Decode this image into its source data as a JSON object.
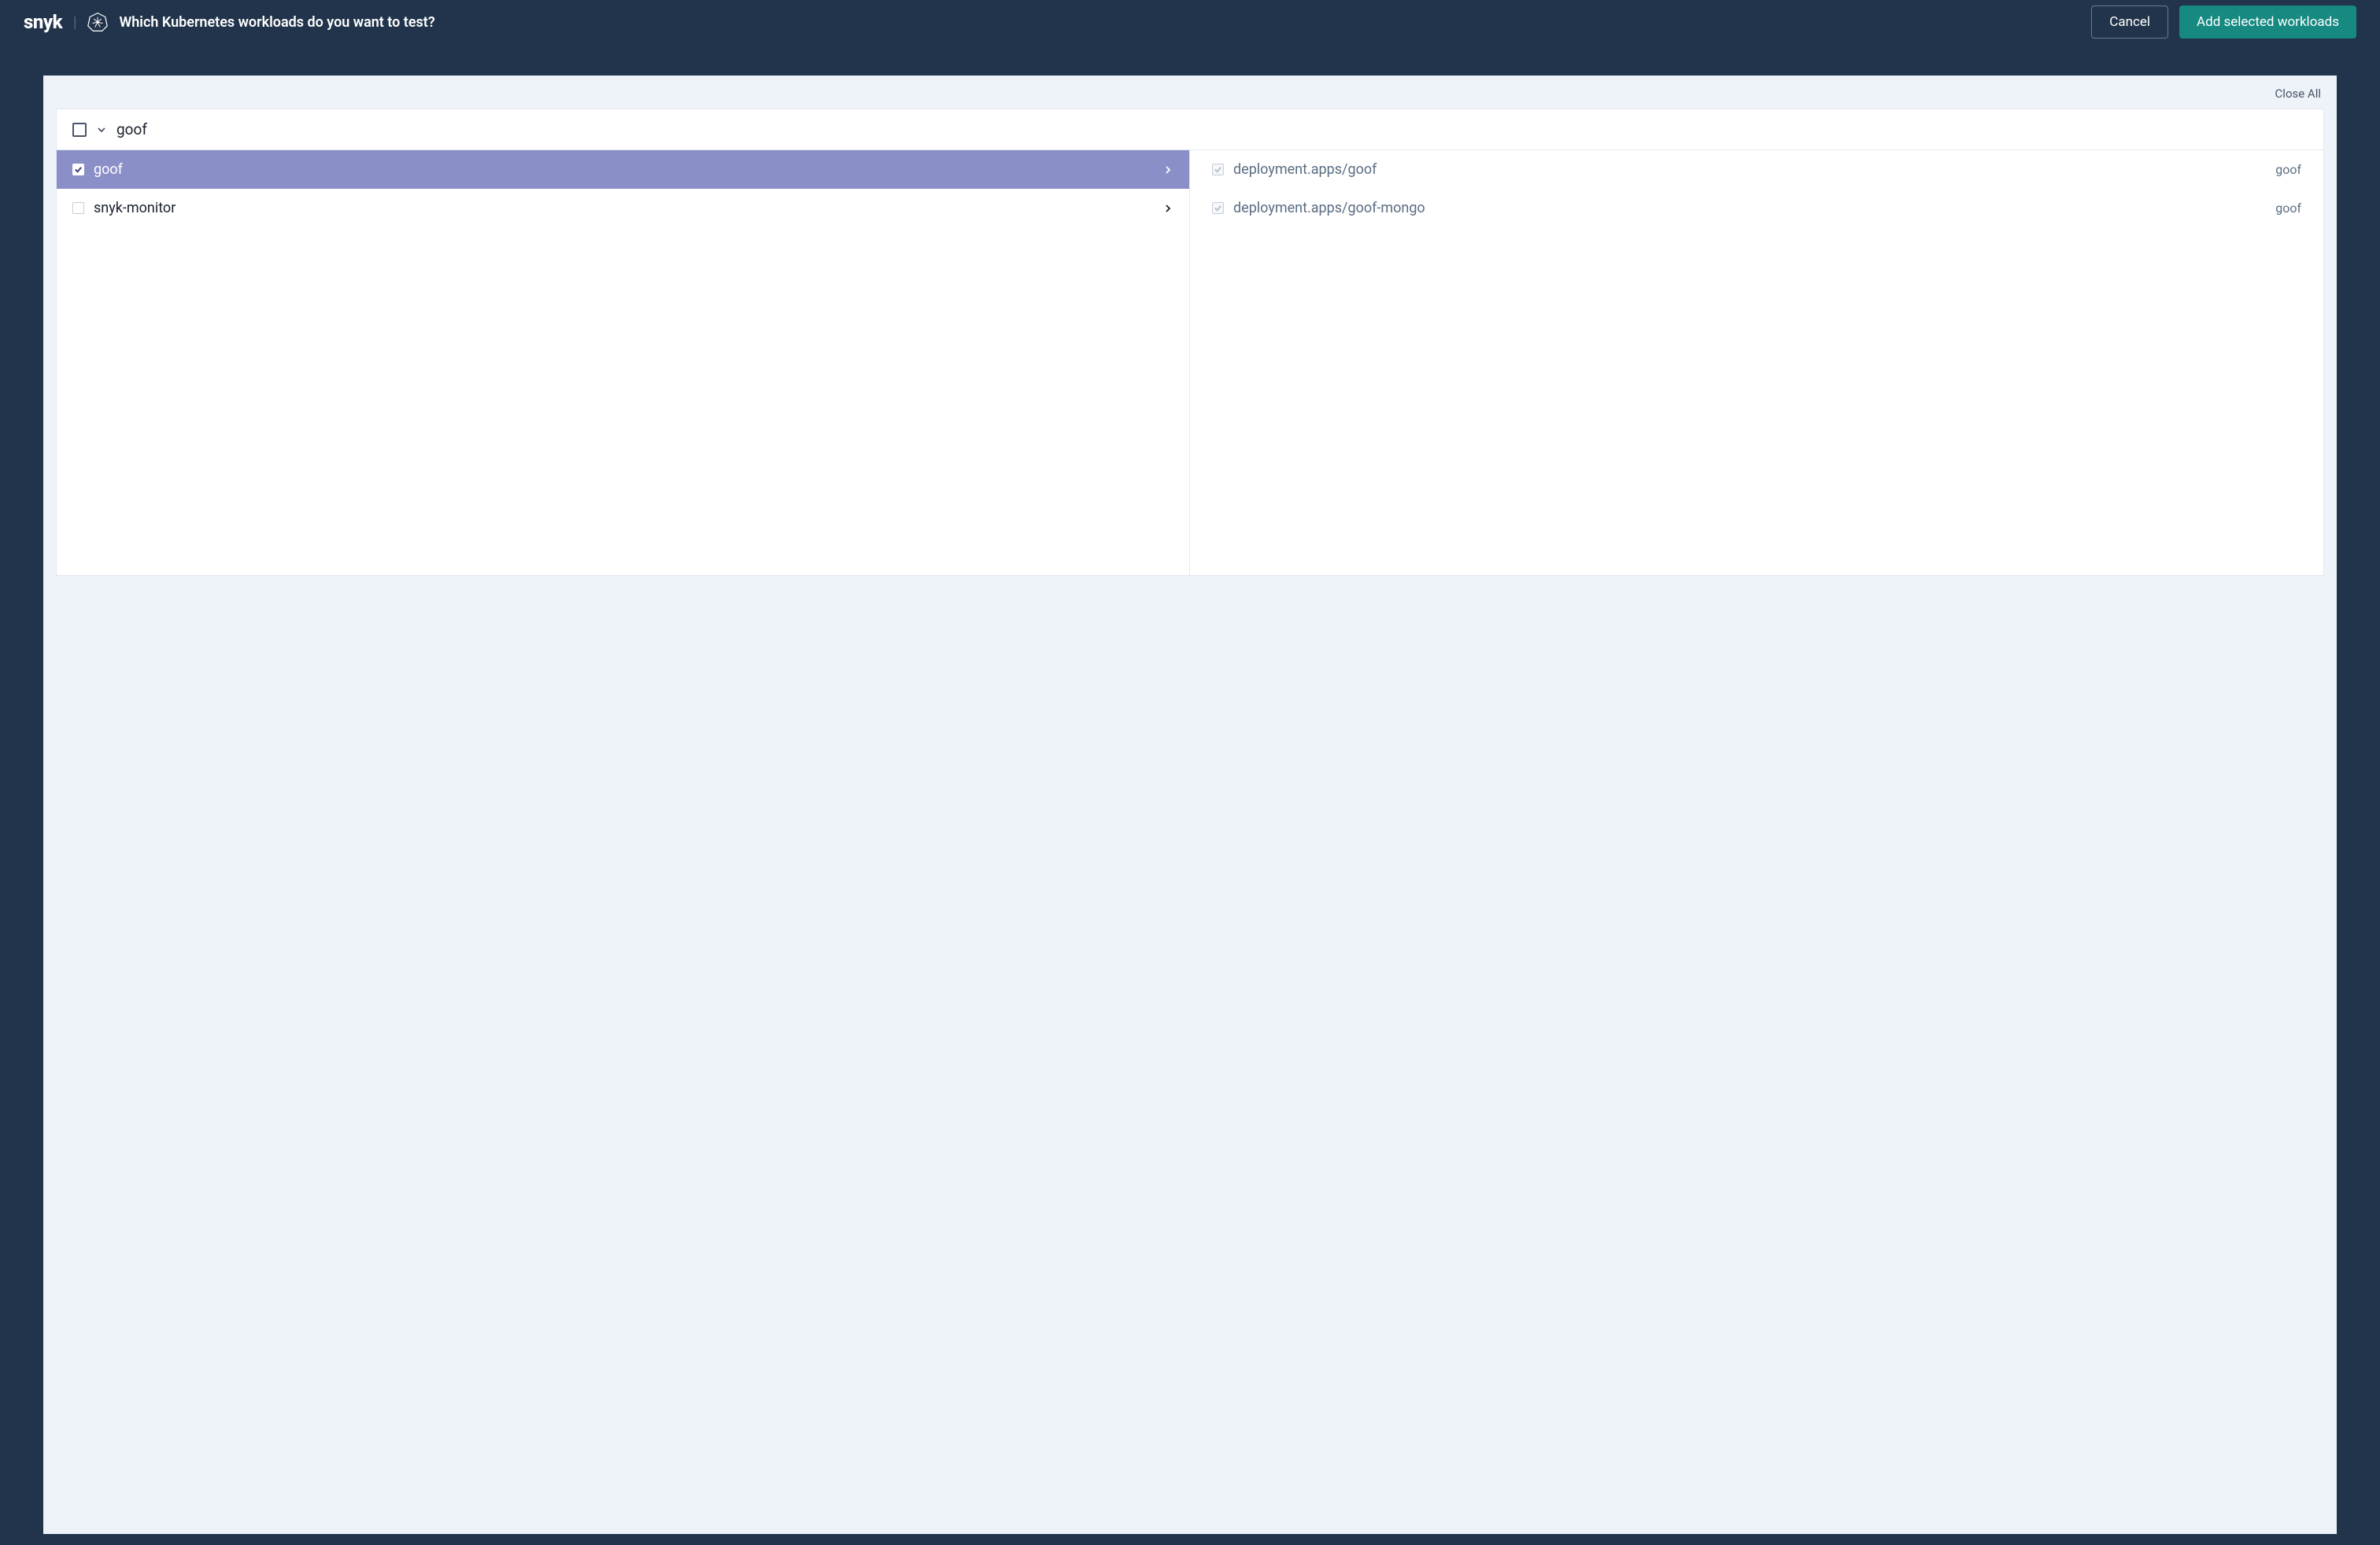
{
  "header": {
    "logo_text": "snyk",
    "title": "Which Kubernetes workloads do you want to test?",
    "cancel_label": "Cancel",
    "add_label": "Add selected workloads"
  },
  "content": {
    "close_all_label": "Close All",
    "cluster_name": "goof",
    "namespaces": [
      {
        "name": "goof",
        "selected": true,
        "checked": true
      },
      {
        "name": "snyk-monitor",
        "selected": false,
        "checked": false
      }
    ],
    "workloads": [
      {
        "name": "deployment.apps/goof",
        "tag": "goof"
      },
      {
        "name": "deployment.apps/goof-mongo",
        "tag": "goof"
      }
    ]
  }
}
